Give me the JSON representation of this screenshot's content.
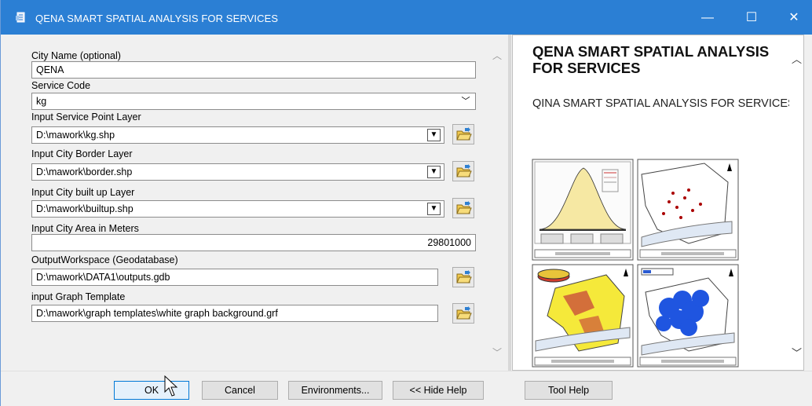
{
  "window": {
    "title": "QENA SMART SPATIAL ANALYSIS FOR SERVICES",
    "icon": "tool-icon",
    "controls": {
      "minimize": "—",
      "maximize": "☐",
      "close": "✕"
    },
    "accent_color": "#2b7fd4"
  },
  "form": {
    "city_name": {
      "label": "City Name (optional)",
      "value": "QENA"
    },
    "service_code": {
      "label": "Service Code",
      "value": "kg"
    },
    "service_point_layer": {
      "label": "Input Service Point Layer",
      "value": "D:\\mawork\\kg.shp"
    },
    "city_border_layer": {
      "label": "Input City Border Layer",
      "value": "D:\\mawork\\border.shp"
    },
    "city_builtup_layer": {
      "label": "Input City built up Layer",
      "value": "D:\\mawork\\builtup.shp"
    },
    "city_area": {
      "label": "Input City Area in Meters",
      "value": "29801000"
    },
    "output_workspace": {
      "label": "OutputWorkspace (Geodatabase)",
      "value": "D:\\mawork\\DATA1\\outputs.gdb"
    },
    "graph_template": {
      "label": "input Graph Template",
      "value": "D:\\mawork\\graph templates\\white graph background.grf"
    }
  },
  "help": {
    "title": "QENA SMART SPATIAL ANALYSIS FOR SERVICES",
    "subtitle": "QINA SMART SPATIAL ANALYSIS FOR SERVICES"
  },
  "buttons": {
    "ok": "OK",
    "cancel": "Cancel",
    "environments": "Environments...",
    "hide_help": "<< Hide Help",
    "tool_help": "Tool Help"
  }
}
